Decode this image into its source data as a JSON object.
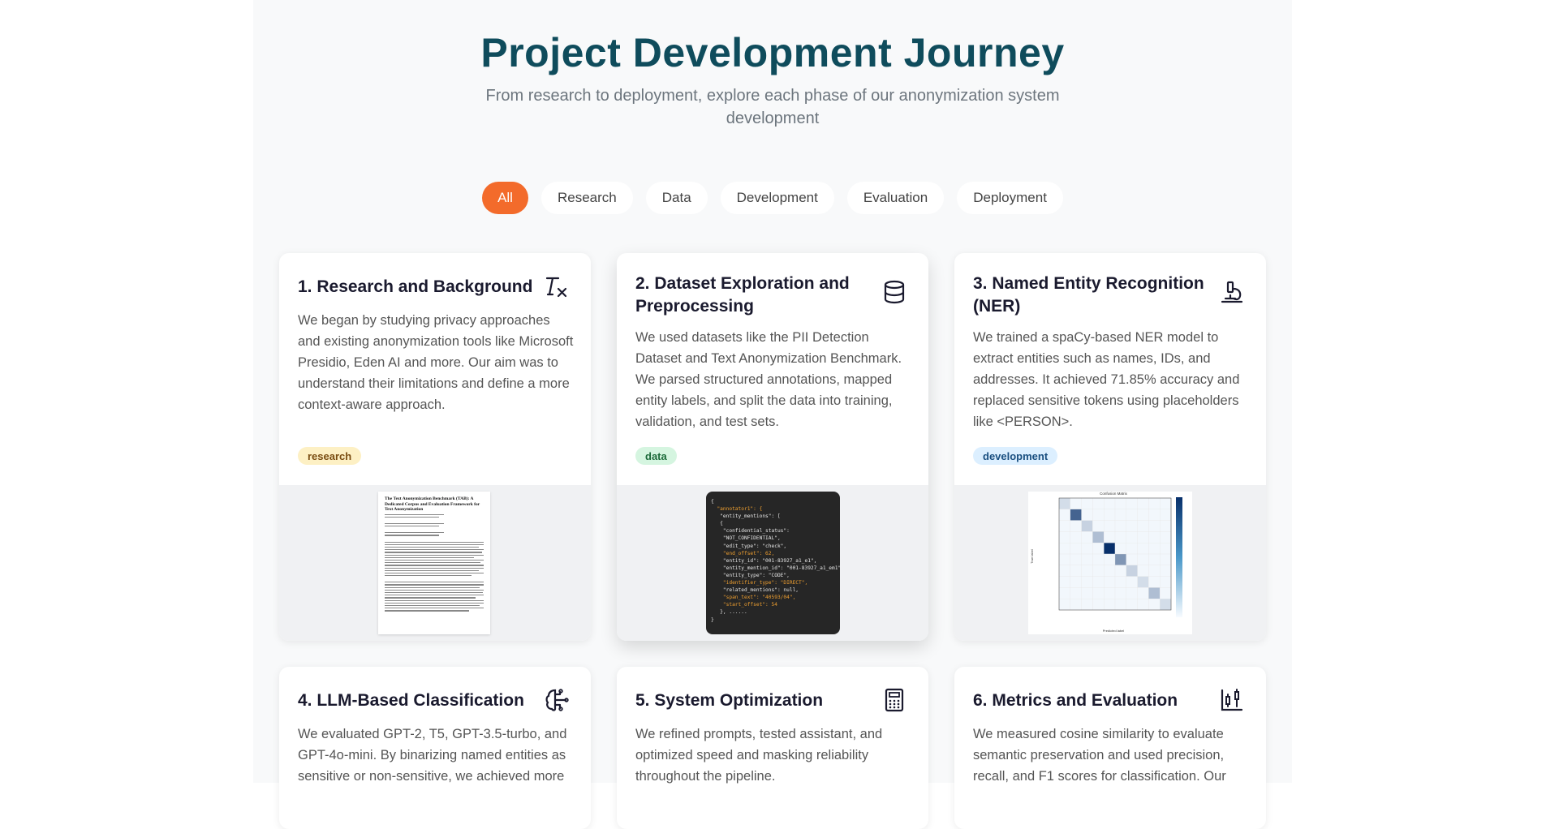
{
  "header": {
    "title": "Project Development Journey",
    "subtitle": "From research to deployment, explore each phase of our anonymization system development"
  },
  "filters": [
    {
      "label": "All",
      "active": true
    },
    {
      "label": "Research",
      "active": false
    },
    {
      "label": "Data",
      "active": false
    },
    {
      "label": "Development",
      "active": false
    },
    {
      "label": "Evaluation",
      "active": false
    },
    {
      "label": "Deployment",
      "active": false
    }
  ],
  "cards": [
    {
      "title": "1. Research and Background",
      "icon": "clear-formatting-icon",
      "description": "We began by studying privacy approaches and existing anonymization tools like Microsoft Presidio, Eden AI and more. Our aim was to understand their limitations and define a more context-aware approach.",
      "tag": "research",
      "preview": {
        "type": "paper",
        "paper_title": "The Text Anonymization Benchmark (TAB): A Dedicated Corpus and Evaluation Framework for Text Anonymization"
      }
    },
    {
      "title": "2. Dataset Exploration and Preprocessing",
      "icon": "database-icon",
      "description": "We used datasets like the PII Detection Dataset and Text Anonymization Benchmark. We parsed structured annotations, mapped entity labels, and split the data into training, validation, and test sets.",
      "tag": "data",
      "preview": {
        "type": "code",
        "code_lines": [
          "{",
          "  \"annotator1\": {",
          "   \"entity_mentions\": [",
          "   {",
          "    \"confidential_status\":",
          "    \"NOT_CONFIDENTIAL\",",
          "    \"edit_type\": \"check\",",
          "    \"end_offset\": 62,",
          "    \"entity_id\": \"001-83927_a1_e1\",",
          "    \"entity_mention_id\": \"001-83927_a1_em1\",",
          "    \"entity_type\": \"CODE\",",
          "    \"identifier_type\": \"DIRECT\",",
          "    \"related_mentions\": null,",
          "    \"span_text\": \"40593/04\",",
          "    \"start_offset\": 54",
          "   }, ......",
          "}"
        ],
        "highlight_lines": [
          1,
          7,
          11,
          13,
          14
        ]
      }
    },
    {
      "title": "3. Named Entity Recognition (NER)",
      "icon": "microscope-icon",
      "description": "We trained a spaCy-based NER model to extract entities such as names, IDs, and addresses. It achieved 71.85% accuracy and replaced sensitive tokens using placeholders like <PERSON>.",
      "tag": "development",
      "preview": {
        "type": "confusion-matrix",
        "matrix_title": "Confusion Matrix",
        "xlabel": "Predicted label",
        "ylabel": "True label"
      }
    },
    {
      "title": "4. LLM-Based Classification",
      "icon": "brain-circuit-icon",
      "description": "We evaluated GPT-2, T5, GPT-3.5-turbo, and GPT-4o-mini. By binarizing named entities as sensitive or non-sensitive, we achieved more"
    },
    {
      "title": "5. System Optimization",
      "icon": "calculator-icon",
      "description": "We refined prompts, tested assistant, and optimized speed and masking reliability throughout the pipeline."
    },
    {
      "title": "6. Metrics and Evaluation",
      "icon": "candlestick-chart-icon",
      "description": "We measured cosine similarity to evaluate semantic preservation and used precision, recall, and F1 scores for classification. Our"
    }
  ]
}
